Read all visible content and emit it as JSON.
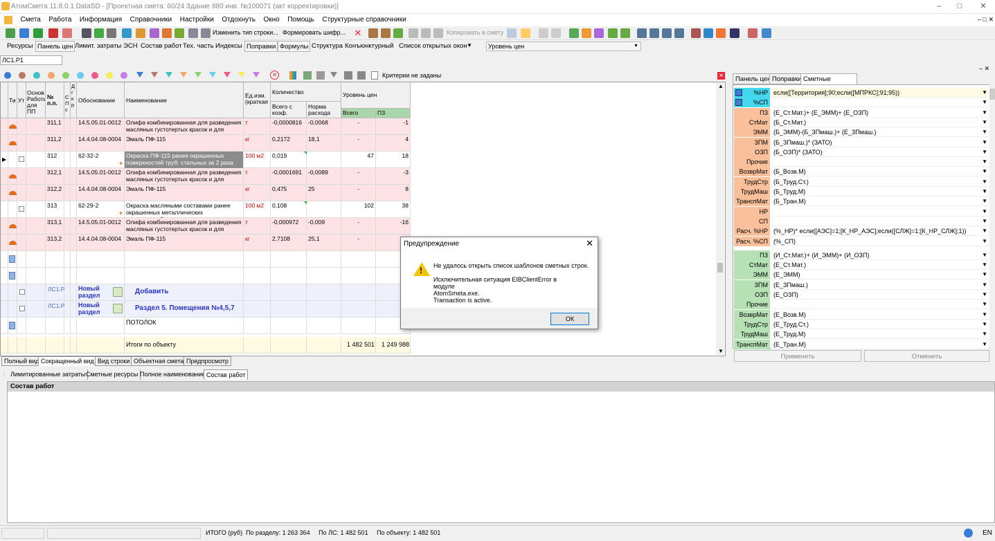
{
  "window": {
    "title": "АтомСмета  11.8.0.1  DataSD - [Проектная смета: 60/24 Здание 880 инв. №100071 (акт корректировки)]"
  },
  "menu": [
    "Смета",
    "Работа",
    "Информация",
    "Справочники",
    "Настройки",
    "Отдохнуть",
    "Окно",
    "Помощь",
    "Структурные справочники"
  ],
  "toolbar1": {
    "change_type": "Изменить тип строки...",
    "form_code": "Формировать шифр...",
    "copy_to_estimate": "Копировать в смету"
  },
  "toolbar2": {
    "tabs": [
      "Ресурсы",
      "Панель цен",
      "Лимит. затраты",
      "ЭСН",
      "Состав работ",
      "Тех. часть",
      "Индексы",
      "Поправки",
      "Формулы",
      "Структура",
      "Конъюнктурный",
      "Список открытых окон"
    ],
    "price_level": "Уровень цен"
  },
  "address": "ЛС1.Р1",
  "filter": {
    "criteria": "Критерии не заданы"
  },
  "grid": {
    "headers": {
      "ti": "Ти",
      "ut": "Ут",
      "base": "Основ Работы для ПП",
      "num": "№ п.п.",
      "s": "С П с",
      "d": "Д г к р",
      "justif": "Обоснование",
      "name": "Наименование",
      "unit": "Ед.изм. (краткая",
      "qty": "Количество",
      "qty_total": "Всего с коэф.",
      "qty_norm": "Норма расхода",
      "price": "Уровень цен",
      "price_total": "Всего",
      "price_pz": "ПЗ"
    },
    "rows": [
      {
        "num": "311,1",
        "code": "14.5.05.01-0012",
        "name": "Олифа комбинированная для разведения масляных густотертых красок и для",
        "unit": "т",
        "qty": "-0,0000816",
        "norm": "-0,0068",
        "total": "-",
        "pz": "-1",
        "kind": "pink"
      },
      {
        "num": "311,2",
        "code": "14.4.04.08-0004",
        "name": "Эмаль ПФ-115",
        "unit": "кг",
        "qty": "0,2172",
        "norm": "18,1",
        "total": "-",
        "pz": "4",
        "kind": "pink"
      },
      {
        "num": "312",
        "code": "62-32-2",
        "name": "Окраска ПФ-115 ранее окрашенных поверхностей труб: стальных за 2 раза",
        "unit": "100 м2",
        "qty": "0,019",
        "norm": "",
        "total": "47",
        "pz": "18",
        "kind": "main"
      },
      {
        "num": "312,1",
        "code": "14.5.05.01-0012",
        "name": "Олифа комбинированная для разведения масляных густотертых красок и для",
        "unit": "т",
        "qty": "-0,0001691",
        "norm": "-0,0089",
        "total": "-",
        "pz": "-3",
        "kind": "pink"
      },
      {
        "num": "312,2",
        "code": "14.4.04.08-0004",
        "name": "Эмаль ПФ-115",
        "unit": "кг",
        "qty": "0,475",
        "norm": "25",
        "total": "-",
        "pz": "8",
        "kind": "pink"
      },
      {
        "num": "313",
        "code": "62-29-2",
        "name": "Окраска масляными составами ранее окрашенных  металлических поверхностей",
        "unit": "100 м2",
        "qty": "0,108",
        "norm": "",
        "total": "102",
        "pz": "38",
        "kind": "main"
      },
      {
        "num": "313,1",
        "code": "14.5.05.01-0012",
        "name": "Олифа комбинированная для разведения масляных густотертых красок и для",
        "unit": "т",
        "qty": "-0,000972",
        "norm": "-0,009",
        "total": "-",
        "pz": "-16",
        "kind": "pink"
      },
      {
        "num": "313,2",
        "code": "14.4.04.08-0004",
        "name": "Эмаль ПФ-115",
        "unit": "кг",
        "qty": "2,7108",
        "norm": "25,1",
        "total": "-",
        "pz": "",
        "kind": "pink"
      }
    ],
    "section1": {
      "ref": "ЛС1.Р",
      "label": "Новый раздел",
      "title": "Добавить"
    },
    "section2": {
      "ref": "ЛС1.Р",
      "label": "Новый раздел",
      "title": "Раздел 5. Помещения №4,5,7"
    },
    "ceiling": "ПОТОЛОК",
    "totals": {
      "label": "Итоги по объекту",
      "total": "1 482 501",
      "pz": "1 249 988"
    }
  },
  "view_tabs": [
    "Полный вид",
    "Сокращенный вид",
    "Вид строки",
    "Объектная смета",
    "Предпросмотр"
  ],
  "lower_tabs": [
    "Лимитированные затраты",
    "Сметные ресурсы",
    "Полное наименование",
    "Состав работ"
  ],
  "lower_header": "Состав работ",
  "status": {
    "text": "ИТОГО (руб)  По разделу: 1 263 364     По ЛС: 1 482 501     По объекту: 1 482 501",
    "lang": "EN"
  },
  "right_panel": {
    "tabs": [
      "Панель цен",
      "Поправки",
      "Сметные формулы"
    ],
    "rows": [
      {
        "label": "%НР",
        "value": "если([Территория];90;если([МПРКС];91;95))",
        "color": "cyan"
      },
      {
        "label": "%СП",
        "value": "",
        "color": "cyan"
      },
      {
        "label": "ПЗ",
        "value": "(Е_Ст.Мат.)+ (Е_ЭММ)+ (Е_ОЗП)",
        "color": "orange"
      },
      {
        "label": "СтМат",
        "value": "(Б_Ст.Мат.)",
        "color": "orange"
      },
      {
        "label": "ЭММ",
        "value": "(Б_ЭММ)-(Б_ЗПмаш.)+ (Е_ЗПмаш.)",
        "color": "orange"
      },
      {
        "label": "ЗПМ",
        "value": "(Б_ЗПмаш.)* (ЗАТО)",
        "color": "orange"
      },
      {
        "label": "ОЗП",
        "value": "(Б_ОЗП)* (ЗАТО)",
        "color": "orange"
      },
      {
        "label": "Прочие",
        "value": "",
        "color": "orange"
      },
      {
        "label": "ВозврМат",
        "value": "(Б_Возв.М)",
        "color": "orange"
      },
      {
        "label": "ТрудСтр",
        "value": "(Б_Труд.Ст.)",
        "color": "orange"
      },
      {
        "label": "ТрудМаш",
        "value": "(Б_Труд.М)",
        "color": "orange"
      },
      {
        "label": "ТранспМат",
        "value": "(Б_Тран.М)",
        "color": "orange"
      },
      {
        "label": "НР",
        "value": "",
        "color": "orange"
      },
      {
        "label": "СП",
        "value": "",
        "color": "orange"
      },
      {
        "label": "Расч. %НР",
        "value": "(%_НР)* если([АЭС]=1;[К_НР_АЭС];если([СЛЖ]=1;[К_НР_СЛЖ];1))",
        "color": "orange"
      },
      {
        "label": "Расч. %СП",
        "value": "(%_СП)",
        "color": "orange"
      },
      {
        "label": "ПЗ",
        "value": "(И_Ст.Мат.)+ (И_ЭММ)+ (И_ОЗП)",
        "color": "green"
      },
      {
        "label": "СтМат",
        "value": "(Е_Ст.Мат.)",
        "color": "green"
      },
      {
        "label": "ЭММ",
        "value": "(Е_ЭММ)",
        "color": "green"
      },
      {
        "label": "ЗПМ",
        "value": "(Е_ЗПмаш.)",
        "color": "green"
      },
      {
        "label": "ОЗП",
        "value": "(Е_ОЗП)",
        "color": "green"
      },
      {
        "label": "Прочие",
        "value": "",
        "color": "green"
      },
      {
        "label": "ВозврМат",
        "value": "(Е_Возв.М)",
        "color": "green"
      },
      {
        "label": "ТрудСтр",
        "value": "(Е_Труд.Ст.)",
        "color": "green"
      },
      {
        "label": "ТрудМаш",
        "value": "(Е_Труд.М)",
        "color": "green"
      },
      {
        "label": "ТранспМат",
        "value": "(Е_Тран.М)",
        "color": "green"
      }
    ],
    "apply": "Применить",
    "cancel": "Отменить"
  },
  "dialog": {
    "title": "Предупреждение",
    "message": "Не удалось открыть список шаблонов сметных строк.",
    "detail1": "Исключительная ситуация EIBClientError в модуле",
    "detail2": "AtomSmeta.exe.",
    "detail3": "Transaction is active.",
    "ok": "ОК"
  }
}
